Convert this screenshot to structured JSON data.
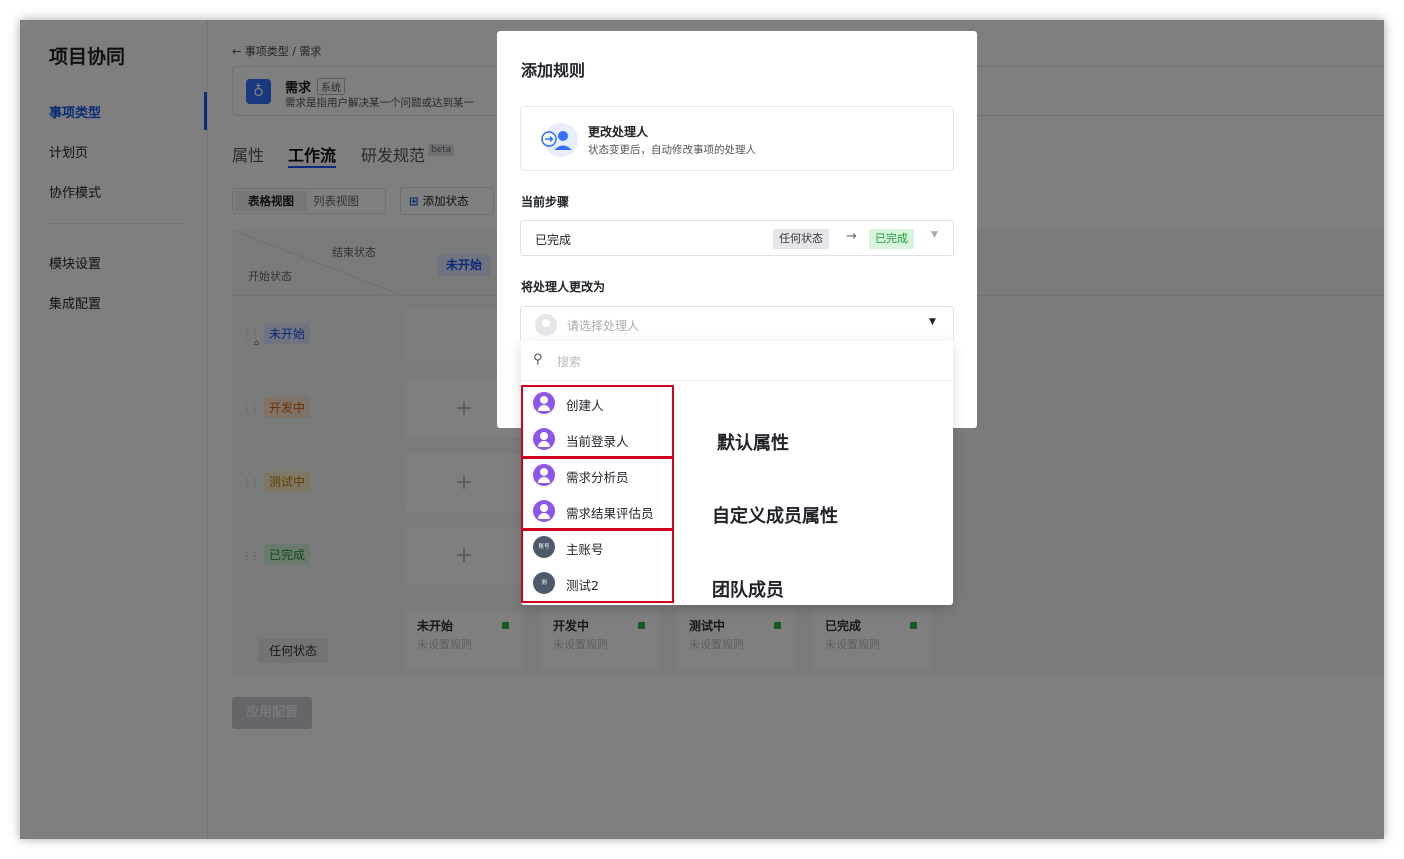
{
  "sidebar": {
    "title": "项目协同",
    "items": [
      {
        "label": "事项类型",
        "active": true
      },
      {
        "label": "计划页"
      },
      {
        "label": "协作模式"
      },
      {
        "label": "模块设置"
      },
      {
        "label": "集成配置"
      }
    ]
  },
  "main": {
    "breadcrumb": "← 事项类型 / 需求",
    "item_card": {
      "name": "需求",
      "tag": "系统",
      "desc": "需求是指用户解决某一个问题或达到某一"
    },
    "tabs": [
      {
        "label": "属性"
      },
      {
        "label": "工作流",
        "active": true
      },
      {
        "label": "研发规范"
      }
    ],
    "beta_tag": "beta",
    "views": {
      "table": "表格视图",
      "list": "列表视图"
    },
    "add_state": "添加状态",
    "grid": {
      "header_end": "结束状态",
      "header_start": "开始状态",
      "col_head": "未开始",
      "rows": [
        {
          "label": "未开始"
        },
        {
          "label": "开发中"
        },
        {
          "label": "测试中"
        },
        {
          "label": "已完成"
        }
      ],
      "any_label": "任何状态",
      "summary": [
        {
          "name": "未开始",
          "sub": "未设置规则"
        },
        {
          "name": "开发中",
          "sub": "未设置规则"
        },
        {
          "name": "测试中",
          "sub": "未设置规则"
        },
        {
          "name": "已完成",
          "sub": "未设置规则"
        }
      ]
    },
    "apply_button": "应用配置"
  },
  "modal": {
    "title": "添加规则",
    "rule": {
      "title": "更改处理人",
      "desc": "状态变更后，自动修改事项的处理人"
    },
    "step_label": "当前步骤",
    "step": {
      "value": "已完成",
      "from": "任何状态",
      "arrow": "→",
      "to": "已完成"
    },
    "assignee_label": "将处理人更改为",
    "assignee_placeholder": "请选择处理人"
  },
  "dropdown": {
    "search_placeholder": "搜索",
    "options": [
      {
        "label": "创建人",
        "icon": "user-icon"
      },
      {
        "label": "当前登录人",
        "icon": "current-user-icon"
      },
      {
        "label": "需求分析员",
        "icon": "user-icon"
      },
      {
        "label": "需求结果评估员",
        "icon": "user-icon"
      },
      {
        "label": "主账号",
        "avatar_text": "账号"
      },
      {
        "label": "测试2",
        "avatar_text": "测"
      }
    ],
    "groups": [
      {
        "note": "默认属性"
      },
      {
        "note": "自定义成员属性"
      },
      {
        "note": "团队成员"
      }
    ]
  },
  "colors": {
    "accent": "#1456f0",
    "highlight": "#d0021b",
    "purple_avatar": "#8d55ed"
  }
}
